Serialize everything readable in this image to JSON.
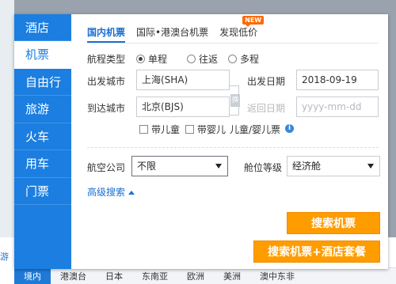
{
  "side_nav": {
    "items": [
      {
        "label": "酒店"
      },
      {
        "label": "机票"
      },
      {
        "label": "自由行"
      },
      {
        "label": "旅游"
      },
      {
        "label": "火车"
      },
      {
        "label": "用车"
      },
      {
        "label": "门票"
      }
    ],
    "active_index": 1
  },
  "tabs": {
    "items": [
      {
        "label": "国内机票"
      },
      {
        "label": "国际•港澳台机票"
      },
      {
        "label": "发现低价"
      }
    ],
    "new_badge": "NEW",
    "active_index": 0
  },
  "trip_type": {
    "label": "航程类型",
    "options": [
      "单程",
      "往返",
      "多程"
    ],
    "selected": "单程"
  },
  "departure": {
    "label": "出发城市",
    "value": "上海(SHA)",
    "date_label": "出发日期",
    "date_value": "2018-09-19"
  },
  "arrival": {
    "label": "到达城市",
    "value": "北京(BJS)",
    "date_label": "返回日期",
    "date_placeholder": "yyyy-mm-dd"
  },
  "swap_button": "换",
  "passengers": {
    "child_label": "带儿童",
    "infant_label": "带婴儿",
    "tickets_label": "儿童/婴儿票",
    "info_glyph": "i"
  },
  "airline": {
    "label": "航空公司",
    "value": "不限"
  },
  "cabin": {
    "label": "舱位等级",
    "value": "经济舱"
  },
  "advanced_search": "高级搜索",
  "buttons": {
    "search_flights": "搜索机票",
    "search_package": "搜索机票+酒店套餐"
  },
  "backdrop": {
    "left_text": "游",
    "bottom_tabs": [
      "境内",
      "港澳台",
      "日本",
      "东南亚",
      "欧洲",
      "美洲",
      "澳中东非"
    ]
  },
  "colors": {
    "nav_blue": "#1b7ee0",
    "accent_blue": "#1b6fd1",
    "button_orange": "#ff9c00",
    "badge_orange": "#ff6a00"
  }
}
